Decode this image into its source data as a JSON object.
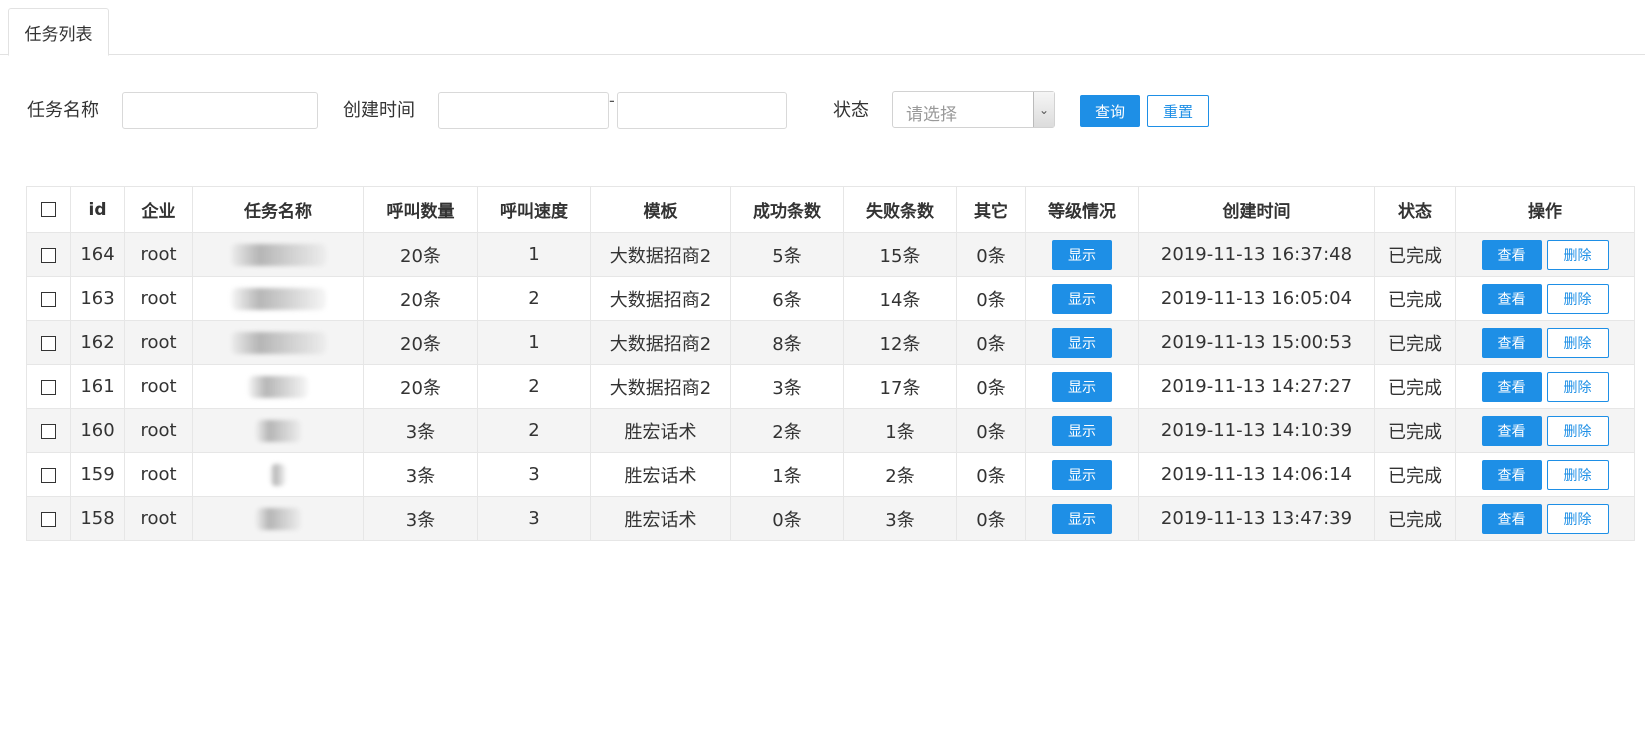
{
  "tabs": [
    {
      "label": "任务列表"
    }
  ],
  "filters": {
    "task_name_label": "任务名称",
    "create_time_label": "创建时间",
    "range_separator": "-",
    "status_label": "状态",
    "status_placeholder": "请选择",
    "query_label": "查询",
    "reset_label": "重置"
  },
  "table": {
    "columns": [
      "id",
      "企业",
      "任务名称",
      "呼叫数量",
      "呼叫速度",
      "模板",
      "成功条数",
      "失败条数",
      "其它",
      "等级情况",
      "创建时间",
      "状态",
      "操作"
    ],
    "show_label": "显示",
    "view_label": "查看",
    "delete_label": "删除",
    "rows": [
      {
        "id": "164",
        "company": "root",
        "call_count": "20条",
        "call_speed": "1",
        "template": "大数据招商2",
        "success": "5条",
        "fail": "15条",
        "other": "0条",
        "created": "2019-11-13 16:37:48",
        "status": "已完成"
      },
      {
        "id": "163",
        "company": "root",
        "call_count": "20条",
        "call_speed": "2",
        "template": "大数据招商2",
        "success": "6条",
        "fail": "14条",
        "other": "0条",
        "created": "2019-11-13 16:05:04",
        "status": "已完成"
      },
      {
        "id": "162",
        "company": "root",
        "call_count": "20条",
        "call_speed": "1",
        "template": "大数据招商2",
        "success": "8条",
        "fail": "12条",
        "other": "0条",
        "created": "2019-11-13 15:00:53",
        "status": "已完成"
      },
      {
        "id": "161",
        "company": "root",
        "call_count": "20条",
        "call_speed": "2",
        "template": "大数据招商2",
        "success": "3条",
        "fail": "17条",
        "other": "0条",
        "created": "2019-11-13 14:27:27",
        "status": "已完成"
      },
      {
        "id": "160",
        "company": "root",
        "call_count": "3条",
        "call_speed": "2",
        "template": "胜宏话术",
        "success": "2条",
        "fail": "1条",
        "other": "0条",
        "created": "2019-11-13 14:10:39",
        "status": "已完成"
      },
      {
        "id": "159",
        "company": "root",
        "call_count": "3条",
        "call_speed": "3",
        "template": "胜宏话术",
        "success": "1条",
        "fail": "2条",
        "other": "0条",
        "created": "2019-11-13 14:06:14",
        "status": "已完成"
      },
      {
        "id": "158",
        "company": "root",
        "call_count": "3条",
        "call_speed": "3",
        "template": "胜宏话术",
        "success": "0条",
        "fail": "3条",
        "other": "0条",
        "created": "2019-11-13 13:47:39",
        "status": "已完成"
      }
    ]
  },
  "colors": {
    "primary": "#1e8fe6",
    "border": "#e6e6e6",
    "stripe": "#f4f4f4"
  }
}
